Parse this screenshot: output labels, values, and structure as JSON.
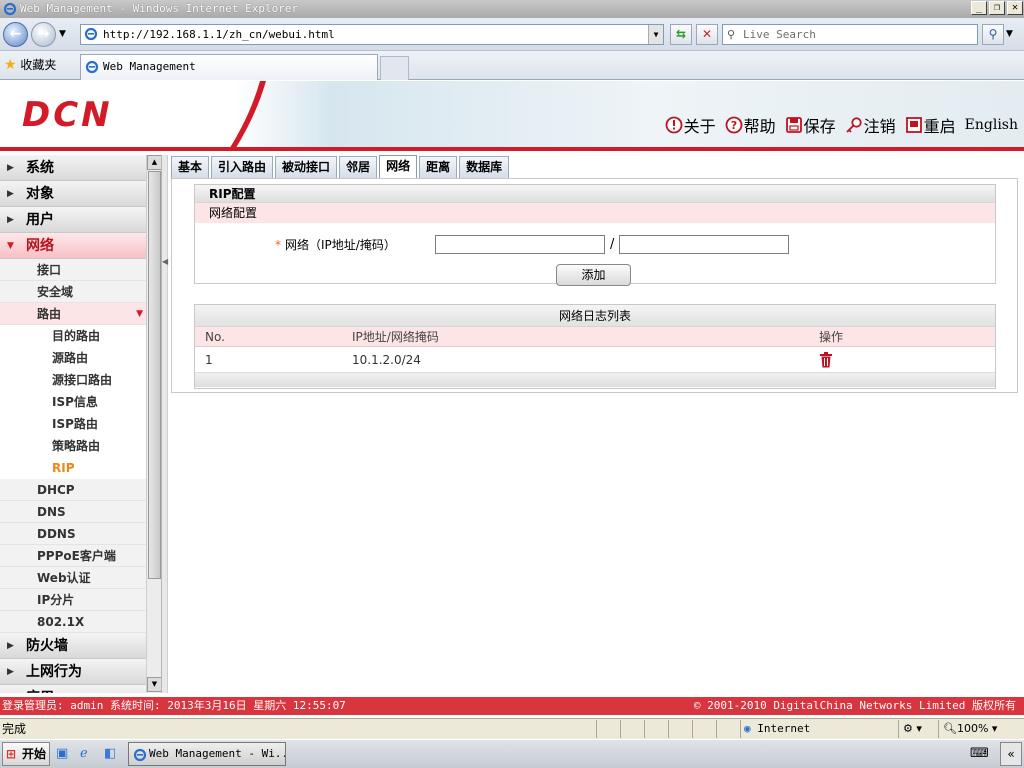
{
  "browser": {
    "window_title": "Web Management - Windows Internet Explorer",
    "url": "http://192.168.1.1/zh_cn/webui.html",
    "search_placeholder": "Live Search",
    "favorites_label": "收藏夹",
    "tab_title": "Web Management",
    "status_text": "完成",
    "zone": "Internet",
    "zoom": "100%"
  },
  "header": {
    "logo": "DCN",
    "links": [
      {
        "label": "关于",
        "icon": "info-icon"
      },
      {
        "label": "帮助",
        "icon": "help-icon"
      },
      {
        "label": "保存",
        "icon": "save-icon"
      },
      {
        "label": "注销",
        "icon": "logout-key-icon"
      },
      {
        "label": "重启",
        "icon": "restart-icon"
      },
      {
        "label": "English",
        "icon": ""
      }
    ]
  },
  "sidebar": {
    "categories_top": [
      "系统",
      "对象",
      "用户"
    ],
    "active_category": "网络",
    "sub_items": [
      "接口",
      "安全域"
    ],
    "active_sub": "路由",
    "route_items": [
      "目的路由",
      "源路由",
      "源接口路由",
      "ISP信息",
      "ISP路由",
      "策略路由"
    ],
    "active_route_item": "RIP",
    "sub_items_after": [
      "DHCP",
      "DNS",
      "DDNS",
      "PPPoE客户端",
      "Web认证",
      "IP分片",
      "802.1X"
    ],
    "categories_bottom": [
      "防火墙",
      "上网行为",
      "应用"
    ]
  },
  "tabs": [
    "基本",
    "引入路由",
    "被动接口",
    "邻居",
    "网络",
    "距离",
    "数据库"
  ],
  "active_tab": "网络",
  "rip_config": {
    "title": "RIP配置",
    "section": "网络配置",
    "field_required_mark": "*",
    "field_label": "网络（IP地址/掩码）",
    "ip_value": "",
    "mask_value": "",
    "separator": "/",
    "add_button": "添加"
  },
  "network_list": {
    "title": "网络日志列表",
    "columns": [
      "No.",
      "IP地址/网络掩码",
      "操作"
    ],
    "rows": [
      {
        "no": "1",
        "network": "10.1.2.0/24",
        "action": "delete-icon"
      }
    ]
  },
  "footer": {
    "left": "登录管理员: admin 系统时间: 2013年3月16日 星期六 12:55:07",
    "right": "© 2001-2010 DigitalChina Networks Limited 版权所有"
  },
  "taskbar": {
    "start_label": "开始",
    "task_label": "Web Management - Wi..."
  },
  "colors": {
    "brand_red": "#d21a28",
    "accent_pink": "#fde4e6",
    "active_orange": "#e8891a"
  }
}
